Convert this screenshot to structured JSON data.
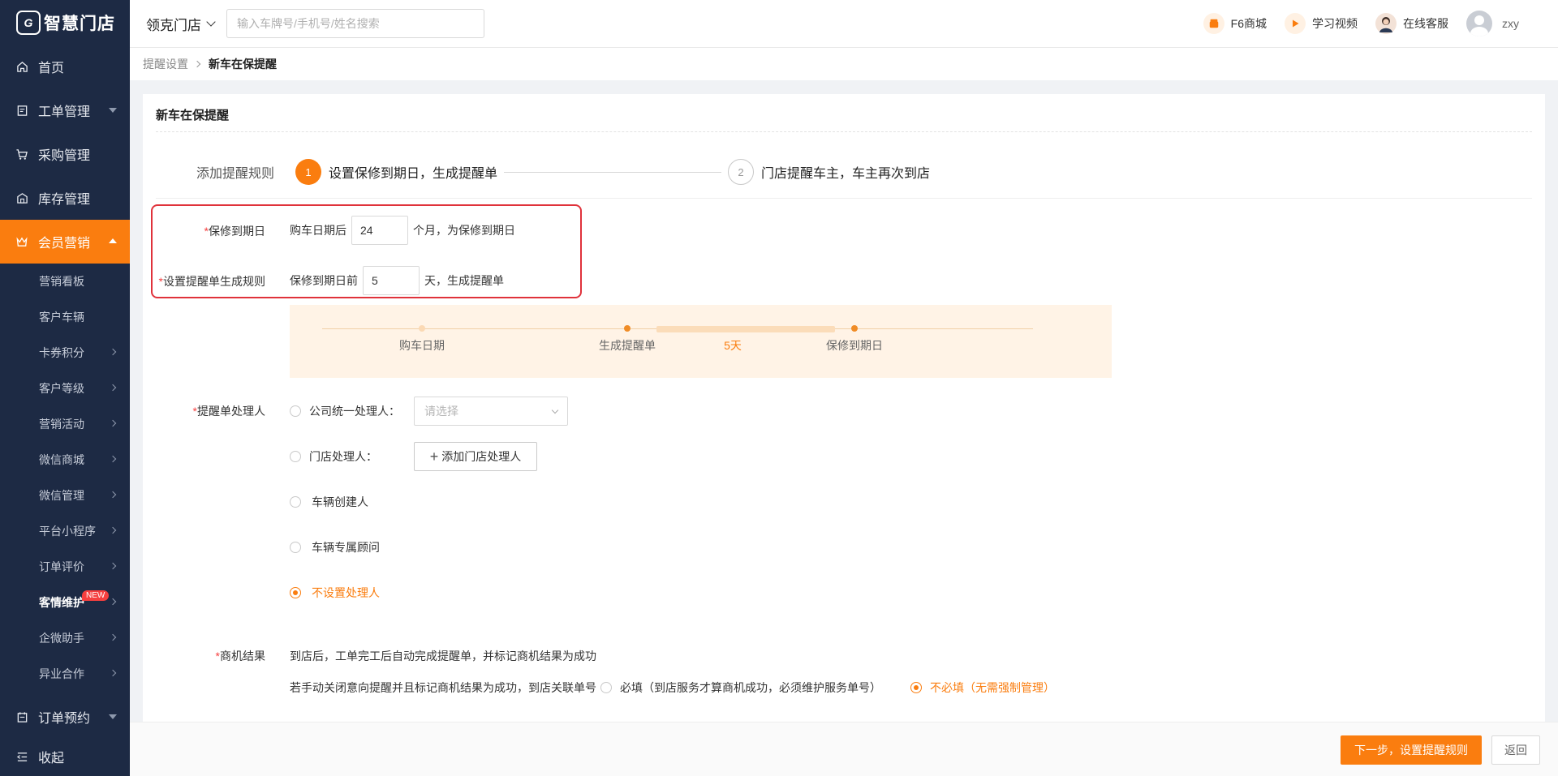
{
  "brand": {
    "logo_text": "智慧门店",
    "accent": "#fa7d0f",
    "sidebar_bg": "#1d2a44"
  },
  "sidebar": {
    "items": [
      {
        "label": "首页",
        "icon": "home-icon"
      },
      {
        "label": "工单管理",
        "icon": "document-icon"
      },
      {
        "label": "采购管理",
        "icon": "cart-icon"
      },
      {
        "label": "库存管理",
        "icon": "warehouse-icon"
      },
      {
        "label": "会员营销",
        "icon": "crown-icon"
      }
    ],
    "sub_items": [
      {
        "label": "营销看板"
      },
      {
        "label": "客户车辆"
      },
      {
        "label": "卡券积分"
      },
      {
        "label": "客户等级"
      },
      {
        "label": "营销活动"
      },
      {
        "label": "微信商城"
      },
      {
        "label": "微信管理"
      },
      {
        "label": "平台小程序"
      },
      {
        "label": "订单评价"
      },
      {
        "label": "客情维护",
        "badge": "NEW"
      },
      {
        "label": "企微助手"
      },
      {
        "label": "异业合作"
      }
    ],
    "bottom_items": [
      {
        "label": "订单预约",
        "icon": "calendar-icon"
      },
      {
        "label": "收起",
        "icon": "collapse-icon"
      }
    ]
  },
  "header": {
    "store": "领克门店",
    "search_placeholder": "输入车牌号/手机号/姓名搜索",
    "links": [
      {
        "label": "F6商城"
      },
      {
        "label": "学习视频"
      },
      {
        "label": "在线客服"
      }
    ],
    "user": "zxy"
  },
  "breadcrumb": {
    "parent": "提醒设置",
    "current": "新车在保提醒"
  },
  "card": {
    "title": "新车在保提醒",
    "steps_label": "添加提醒规则",
    "steps": [
      {
        "num": "1",
        "text": "设置保修到期日，生成提醒单"
      },
      {
        "num": "2",
        "text": "门店提醒车主，车主再次到店"
      }
    ],
    "warranty": {
      "label": "保修到期日",
      "prefix": "购车日期后",
      "value": "24",
      "suffix": "个月，为保修到期日"
    },
    "rule": {
      "label": "设置提醒单生成规则",
      "prefix": "保修到期日前",
      "value": "5",
      "suffix": "天，生成提醒单"
    },
    "timeline": {
      "start": "购车日期",
      "mid": "生成提醒单",
      "days": "5天",
      "end": "保修到期日"
    },
    "handler": {
      "label": "提醒单处理人",
      "options": [
        {
          "label": "公司统一处理人：",
          "selected": false
        },
        {
          "label": "门店处理人：",
          "selected": false
        },
        {
          "label": "车辆创建人",
          "selected": false
        },
        {
          "label": "车辆专属顾问",
          "selected": false
        },
        {
          "label": "不设置处理人",
          "selected": true
        }
      ],
      "select_placeholder": "请选择",
      "add_button": "添加门店处理人"
    },
    "opportunity": {
      "label": "商机结果",
      "desc": "到店后，工单完工后自动完成提醒单，并标记商机结果为成功",
      "manual_text": "若手动关闭意向提醒并且标记商机结果为成功，到店关联单号",
      "options": [
        {
          "label": "必填（到店服务才算商机成功，必须维护服务单号）",
          "selected": false
        },
        {
          "label": "不必填（无需强制管理）",
          "selected": true
        }
      ]
    }
  },
  "footer": {
    "next": "下一步，设置提醒规则",
    "back": "返回"
  }
}
